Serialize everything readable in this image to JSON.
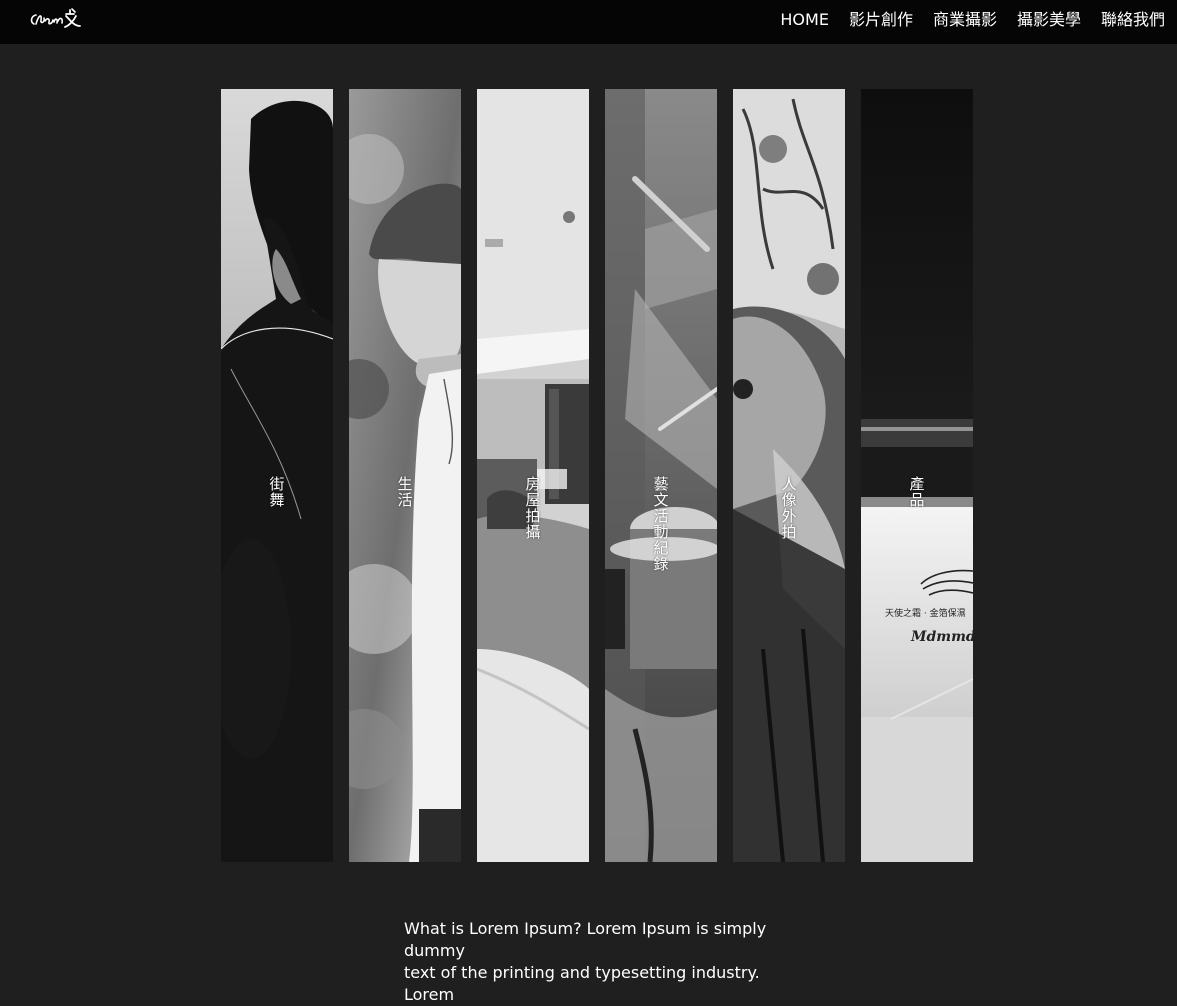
{
  "header": {
    "logo_text": "C.Ban文",
    "nav": [
      {
        "label": "HOME"
      },
      {
        "label": "影片創作"
      },
      {
        "label": "商業攝影"
      },
      {
        "label": "攝影美學"
      },
      {
        "label": "聯絡我們"
      }
    ]
  },
  "gallery": {
    "strips": [
      {
        "label": "街舞",
        "photo": "street-dancer-portrait"
      },
      {
        "label": "生活",
        "photo": "man-in-cap-smiling"
      },
      {
        "label": "房屋拍攝",
        "photo": "bedroom-interior"
      },
      {
        "label": "藝文活動紀錄",
        "photo": "drummer-performance"
      },
      {
        "label": "人像外拍",
        "photo": "outdoor-portrait-with-mask"
      },
      {
        "label": "產品",
        "photo": "cosmetic-cream-jar",
        "product_brand_text": "天使之霜 · 金箔保濕",
        "product_logo_text": "Mdmmd"
      }
    ]
  },
  "description": {
    "line1": "What is Lorem Ipsum? Lorem Ipsum is simply dummy",
    "line2": "text of the printing and typesetting industry. Lorem"
  },
  "colors": {
    "page_background": "#1f1f1f",
    "topbar_background": "#050505",
    "text": "#ffffff"
  }
}
